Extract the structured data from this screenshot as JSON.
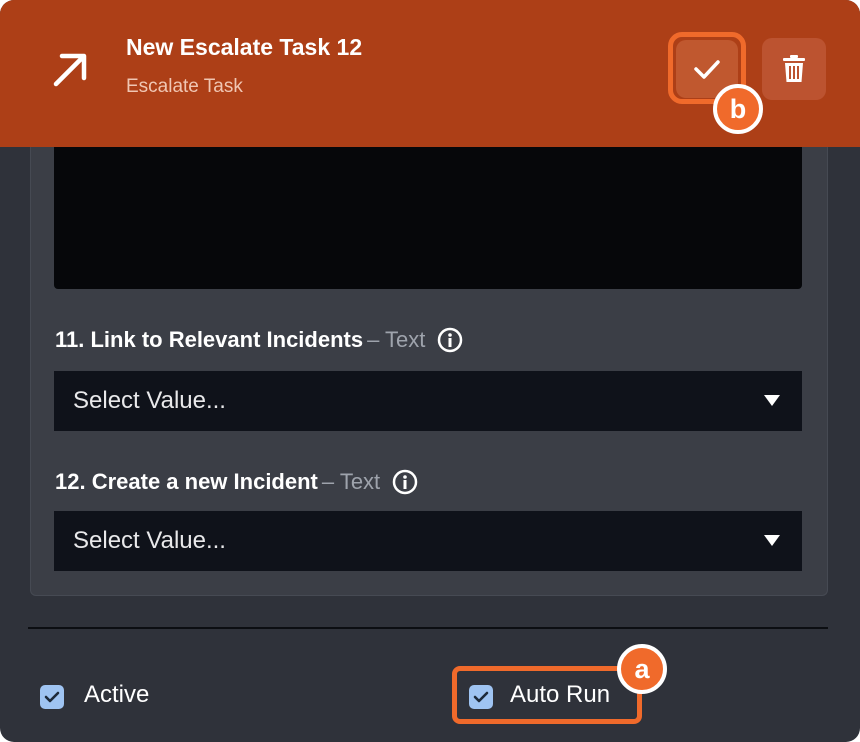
{
  "header": {
    "title": "New Escalate Task 12",
    "subtitle": "Escalate Task",
    "icon": "arrow-up-right-icon",
    "confirm_icon": "checkmark-icon",
    "delete_icon": "trash-icon",
    "accent_color": "#ad3f17"
  },
  "annotations": {
    "badge_a": "a",
    "badge_b": "b",
    "highlight_color": "#f06a2b"
  },
  "fields": [
    {
      "title": "11. Link to Relevant Incidents",
      "type": "– Text",
      "value": "Select Value..."
    },
    {
      "title": "12. Create a new Incident",
      "type": "– Text",
      "value": "Select Value..."
    }
  ],
  "footer": {
    "active_label": "Active",
    "active_checked": true,
    "autorun_label": "Auto Run",
    "autorun_checked": true
  }
}
